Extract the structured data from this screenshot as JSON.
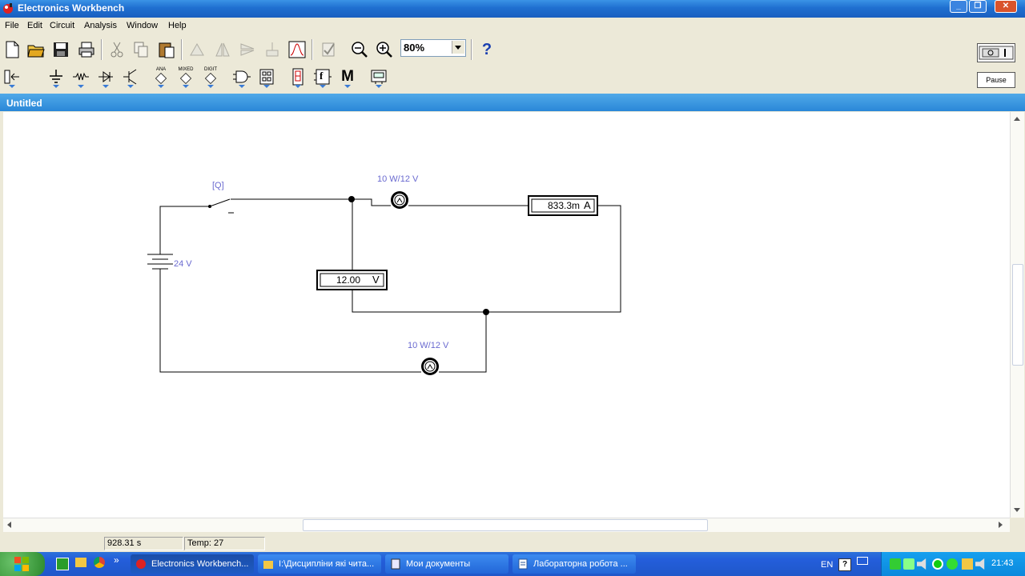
{
  "app": {
    "title": "Electronics Workbench"
  },
  "window_controls": {
    "minimize": "_",
    "restore": "❐",
    "close": "✕"
  },
  "menu": [
    "File",
    "Edit",
    "Circuit",
    "Analysis",
    "Window",
    "Help"
  ],
  "toolbar": {
    "zoom_value": "80%",
    "help_label": "?",
    "pause_label": "Pause",
    "parts_labels": {
      "analog": "ANA",
      "mixed": "MIXED",
      "digital": "DIGIT",
      "function": "f",
      "misc": "M"
    }
  },
  "document": {
    "title": "Untitled"
  },
  "circuit": {
    "switch_key": "[Q]",
    "battery_label": "24 V",
    "lamp1_label": "10 W/12 V",
    "lamp2_label": "10 W/12 V",
    "ammeter_value": "833.3m",
    "ammeter_unit": "A",
    "voltmeter_value": "12.00",
    "voltmeter_unit": "V"
  },
  "status": {
    "time": "928.31 s",
    "temp_label": "Temp:",
    "temp_value": "27"
  },
  "taskbar": {
    "items": [
      {
        "label": "Electronics Workbench..."
      },
      {
        "label": "I:\\Дисципліни які чита..."
      },
      {
        "label": "Мои документы"
      },
      {
        "label": "Лабораторна робота ..."
      }
    ],
    "lang": "EN",
    "clock": "21:43"
  },
  "colors": {
    "titlebar": "#1f6fd0",
    "circuit_label": "#6a6ad0",
    "wire": "#000000"
  }
}
